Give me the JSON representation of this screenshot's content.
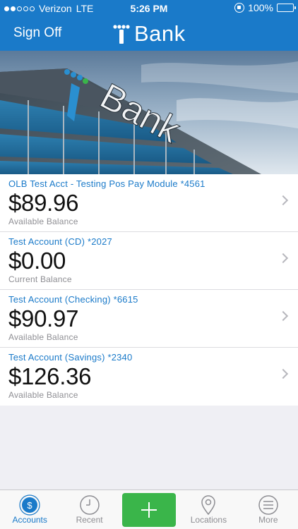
{
  "status_bar": {
    "carrier": "Verizon",
    "network": "LTE",
    "time": "5:26 PM",
    "battery": "100%",
    "signal_bars_filled": 2,
    "signal_bars_total": 5
  },
  "nav": {
    "sign_off_label": "Sign Off",
    "brand_name": "Bank",
    "brand_color": "#1a7ac9"
  },
  "hero": {
    "sign_text": "Bank"
  },
  "accounts": [
    {
      "name": "OLB Test Acct - Testing Pos Pay Module *4561",
      "balance": "$89.96",
      "balance_type": "Available Balance"
    },
    {
      "name": "Test Account (CD) *2027",
      "balance": "$0.00",
      "balance_type": "Current Balance"
    },
    {
      "name": "Test Account (Checking) *6615",
      "balance": "$90.97",
      "balance_type": "Available Balance"
    },
    {
      "name": "Test Account (Savings) *2340",
      "balance": "$126.36",
      "balance_type": "Available Balance"
    }
  ],
  "tab_bar": {
    "tabs": [
      {
        "label": "Accounts",
        "icon": "dollar-icon",
        "active": true
      },
      {
        "label": "Recent",
        "icon": "clock-icon",
        "active": false
      },
      {
        "label": "",
        "icon": "plus-icon",
        "active": false
      },
      {
        "label": "Locations",
        "icon": "map-pin-icon",
        "active": false
      },
      {
        "label": "More",
        "icon": "menu-icon",
        "active": false
      }
    ],
    "active_color": "#1a7ac9",
    "add_button_color": "#3ab54a"
  }
}
